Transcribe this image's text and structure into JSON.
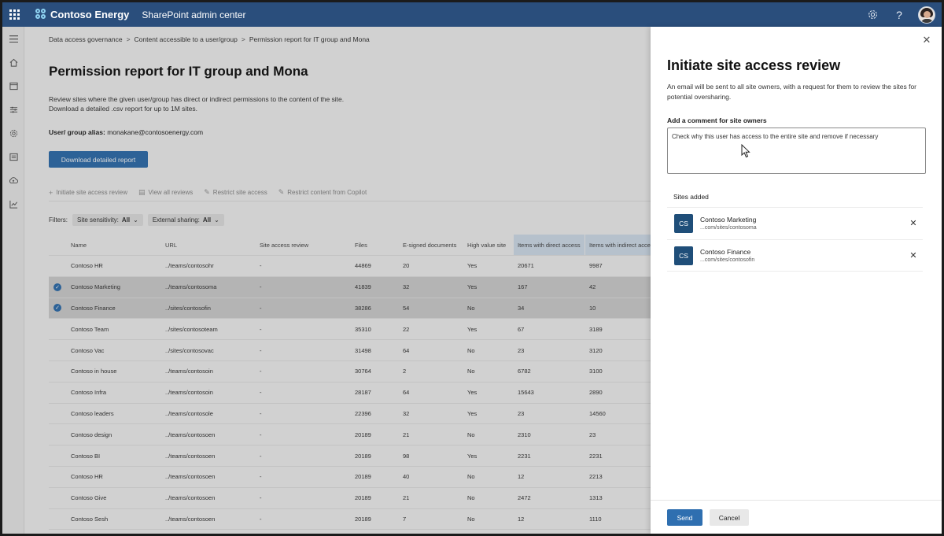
{
  "topbar": {
    "brand": "Contoso Energy",
    "app": "SharePoint admin center",
    "icons": [
      "app-launcher-icon",
      "settings-icon",
      "help-icon",
      "user-avatar"
    ]
  },
  "rail": {
    "items": [
      "menu-icon",
      "home-icon",
      "sites-icon",
      "policies-icon",
      "settings-icon",
      "content-services-icon",
      "migration-icon",
      "reports-icon"
    ]
  },
  "breadcrumb": [
    "Data access governance",
    "Content accessible to a user/group",
    "Permission report for IT group and Mona"
  ],
  "page": {
    "title": "Permission report for IT group and Mona",
    "desc_line1": "Review sites where the given user/group has direct or indirect permissions to the content of the site.",
    "desc_line2": "Download a detailed .csv report for up to 1M sites.",
    "alias_label": "User/ group alias:",
    "alias_value": "monakane@contosoenergy.com",
    "download_button": "Download detailed report"
  },
  "commands": [
    "Initiate site access review",
    "View all reviews",
    "Restrict site access",
    "Restrict content from Copilot"
  ],
  "filters": {
    "label": "Filters:",
    "sensitivity_label": "Site sensitivity:",
    "sensitivity_value": "All",
    "sharing_label": "External sharing:",
    "sharing_value": "All"
  },
  "table": {
    "columns": [
      "Name",
      "URL",
      "Site access review",
      "Files",
      "E-signed documents",
      "High value site",
      "Items with direct access",
      "Items with indirect access"
    ],
    "rows": [
      {
        "name": "Contoso HR",
        "url": "../teams/contosohr",
        "review": "-",
        "files": "44869",
        "esign": "20",
        "high": "Yes",
        "direct": "20671",
        "indirect": "9987",
        "selected": false
      },
      {
        "name": "Contoso Marketing",
        "url": "../teams/contosoma",
        "review": "-",
        "files": "41839",
        "esign": "32",
        "high": "Yes",
        "direct": "167",
        "indirect": "42",
        "selected": true
      },
      {
        "name": "Contoso Finance",
        "url": "../sites/contosofin",
        "review": "-",
        "files": "38286",
        "esign": "54",
        "high": "No",
        "direct": "34",
        "indirect": "10",
        "selected": true
      },
      {
        "name": "Contoso Team",
        "url": "../sites/contosoteam",
        "review": "-",
        "files": "35310",
        "esign": "22",
        "high": "Yes",
        "direct": "67",
        "indirect": "3189",
        "selected": false
      },
      {
        "name": "Contoso Vac",
        "url": "../sites/contosovac",
        "review": "-",
        "files": "31498",
        "esign": "64",
        "high": "No",
        "direct": "23",
        "indirect": "3120",
        "selected": false
      },
      {
        "name": "Contoso in house",
        "url": "../teams/contosoin",
        "review": "-",
        "files": "30764",
        "esign": "2",
        "high": "No",
        "direct": "6782",
        "indirect": "3100",
        "selected": false
      },
      {
        "name": "Contoso Infra",
        "url": "../teams/contosoin",
        "review": "-",
        "files": "28187",
        "esign": "64",
        "high": "Yes",
        "direct": "15643",
        "indirect": "2890",
        "selected": false
      },
      {
        "name": "Contoso leaders",
        "url": "../teams/contosole",
        "review": "-",
        "files": "22396",
        "esign": "32",
        "high": "Yes",
        "direct": "23",
        "indirect": "14560",
        "selected": false
      },
      {
        "name": "Contoso design",
        "url": "../teams/contosoen",
        "review": "-",
        "files": "20189",
        "esign": "21",
        "high": "No",
        "direct": "2310",
        "indirect": "23",
        "selected": false
      },
      {
        "name": "Contoso BI",
        "url": "../teams/contosoen",
        "review": "-",
        "files": "20189",
        "esign": "98",
        "high": "Yes",
        "direct": "2231",
        "indirect": "2231",
        "selected": false
      },
      {
        "name": "Contoso HR",
        "url": "../teams/contosoen",
        "review": "-",
        "files": "20189",
        "esign": "40",
        "high": "No",
        "direct": "12",
        "indirect": "2213",
        "selected": false
      },
      {
        "name": "Contoso Give",
        "url": "../teams/contosoen",
        "review": "-",
        "files": "20189",
        "esign": "21",
        "high": "No",
        "direct": "2472",
        "indirect": "1313",
        "selected": false
      },
      {
        "name": "Contoso Sesh",
        "url": "../teams/contosoen",
        "review": "-",
        "files": "20189",
        "esign": "7",
        "high": "No",
        "direct": "12",
        "indirect": "1110",
        "selected": false
      }
    ]
  },
  "panel": {
    "title": "Initiate site access review",
    "desc": "An email will be sent to all site owners, with a request for them to review the sites for potential oversharing.",
    "comment_label": "Add a comment for site owners",
    "comment_value": "Check why this user has access to the entire site and remove if necessary",
    "sites_label": "Sites added",
    "sites": [
      {
        "badge": "CS",
        "name": "Contoso Marketing",
        "url": "...com/sites/contosoma"
      },
      {
        "badge": "CS",
        "name": "Contoso Finance",
        "url": "...com/sites/contosofin"
      }
    ],
    "send": "Send",
    "cancel": "Cancel"
  },
  "colors": {
    "suite_bar": "#2a4e7c",
    "primary": "#2f6fb0",
    "site_badge": "#1f4e79"
  }
}
